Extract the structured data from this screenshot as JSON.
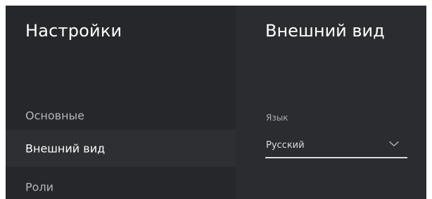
{
  "sidebar": {
    "title": "Настройки",
    "items": [
      {
        "label": "Основные",
        "active": false
      },
      {
        "label": "Внешний вид",
        "active": true
      },
      {
        "label": "Роли",
        "active": false
      }
    ]
  },
  "main": {
    "title": "Внешний вид",
    "language": {
      "label": "Язык",
      "value": "Русский",
      "icon": "chevron-down-icon"
    }
  },
  "colors": {
    "sidebar_bg": "#26272b",
    "panel_bg": "#2b2c30",
    "active_item_bg": "#2e2f33",
    "text_primary": "#ffffff",
    "text_secondary": "#b4b6bb"
  }
}
